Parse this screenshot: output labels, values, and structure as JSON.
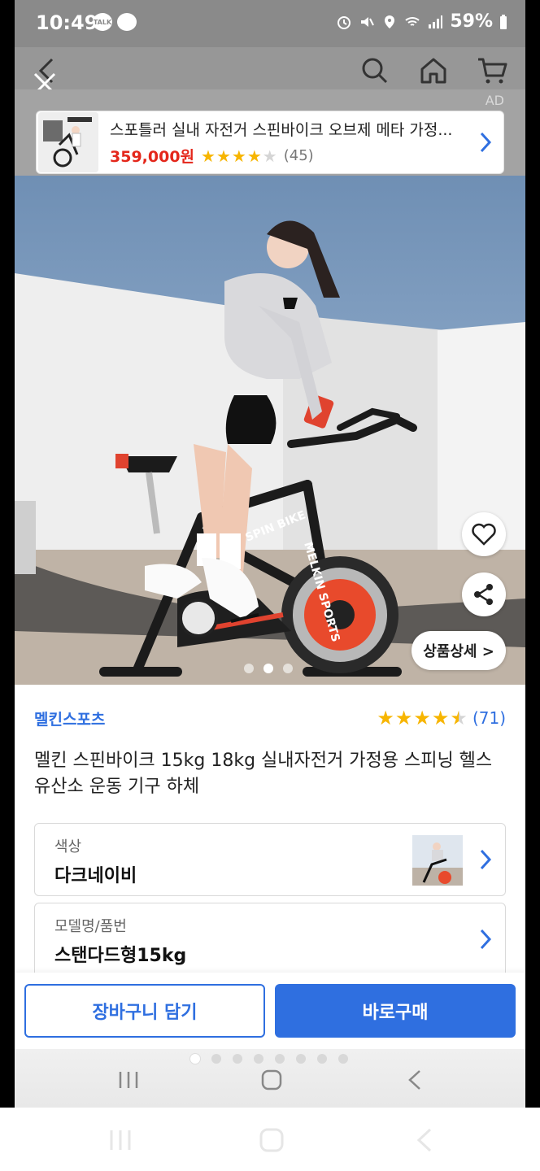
{
  "status_bar": {
    "time": "10:49",
    "talk_badge": "TALK",
    "battery": "59%"
  },
  "nav": {
    "back_icon": "back-chevron-icon",
    "close_icon": "close-icon",
    "search_icon": "search-icon",
    "home_icon": "home-icon",
    "cart_icon": "cart-icon"
  },
  "ad": {
    "label": "AD",
    "title": "스포틀러 실내 자전거 스핀바이크 오브제 메타 가정...",
    "price": "359,000원",
    "rating": 4,
    "review_count": "(45)"
  },
  "hero": {
    "page_count": 3,
    "active_page": 1,
    "detail_button": "상품상세 >"
  },
  "product": {
    "brand": "멜킨스포츠",
    "rating": 4.5,
    "review_count": "(71)",
    "title": "멜킨 스핀바이크 15kg 18kg 실내자전거 가정용 스피닝 헬스 유산소 운동 기구 하체"
  },
  "options": [
    {
      "label": "색상",
      "value": "다크네이비"
    },
    {
      "label": "모델명/품번",
      "value": "스탠다드형15kg"
    }
  ],
  "actions": {
    "add_to_cart": "장바구니 담기",
    "buy_now": "바로구매"
  },
  "colors": {
    "accent": "#2f6fe0",
    "price_red": "#e4271b",
    "star": "#f7b500"
  }
}
